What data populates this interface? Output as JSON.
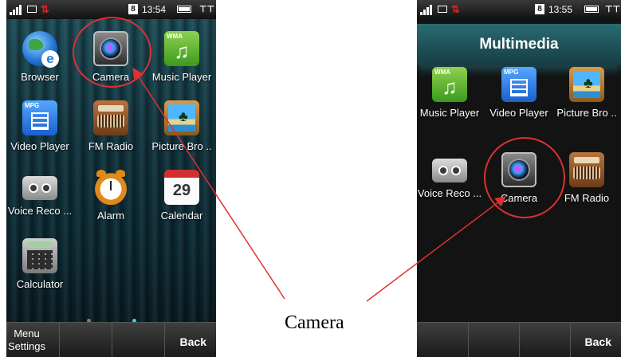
{
  "left_phone": {
    "status": {
      "clock_icon_label": "8",
      "time": "13:54"
    },
    "apps": [
      {
        "label": "Browser",
        "icon": "browser-icon"
      },
      {
        "label": "Camera",
        "icon": "camera-icon"
      },
      {
        "label": "Music Player",
        "icon": "music-player-icon",
        "tag": "WMA"
      },
      {
        "label": "Video Player",
        "icon": "video-player-icon",
        "tag": "MPG"
      },
      {
        "label": "FM Radio",
        "icon": "fm-radio-icon"
      },
      {
        "label": "Picture Bro ..",
        "icon": "picture-browser-icon"
      },
      {
        "label": "Voice Reco ...",
        "icon": "voice-recorder-icon"
      },
      {
        "label": "Alarm",
        "icon": "alarm-icon"
      },
      {
        "label": "Calendar",
        "icon": "calendar-icon",
        "day": "29"
      },
      {
        "label": "Calculator",
        "icon": "calculator-icon"
      }
    ],
    "softkeys": {
      "left_line1": "Menu",
      "left_line2": "Settings",
      "right": "Back"
    }
  },
  "right_phone": {
    "status": {
      "clock_icon_label": "8",
      "time": "13:55"
    },
    "title": "Multimedia",
    "apps": [
      {
        "label": "Music Player",
        "icon": "music-player-icon",
        "tag": "WMA"
      },
      {
        "label": "Video Player",
        "icon": "video-player-icon",
        "tag": "MPG"
      },
      {
        "label": "Picture Bro ..",
        "icon": "picture-browser-icon"
      },
      {
        "label": "Voice Reco ...",
        "icon": "voice-recorder-icon"
      },
      {
        "label": "Camera",
        "icon": "camera-icon"
      },
      {
        "label": "FM Radio",
        "icon": "fm-radio-icon"
      }
    ],
    "softkeys": {
      "right": "Back"
    }
  },
  "annotation": {
    "caption": "Camera",
    "color": "#e03030"
  },
  "colors": {
    "active_page_dot": "#3fd0e8",
    "inactive_page_dot": "#7a7a7a",
    "network_badge": "#e02020"
  }
}
